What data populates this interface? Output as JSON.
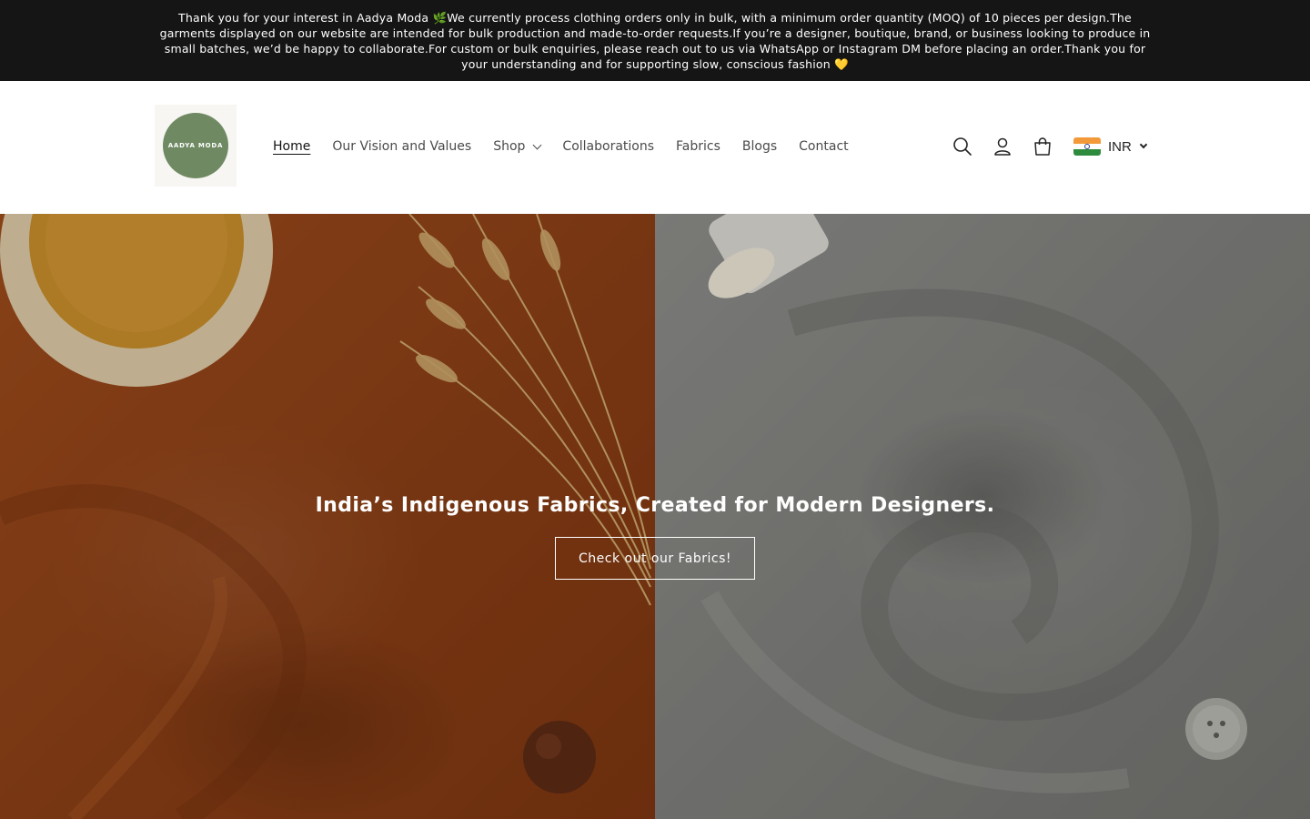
{
  "announcement": {
    "text": "Thank you for your interest in Aadya Moda 🌿We currently process clothing orders only in bulk, with a minimum order quantity (MOQ) of 10 pieces per design.The garments displayed on our website are intended for bulk production and made-to-order requests.If you’re a designer, boutique, brand, or business looking to produce in small batches, we’d be happy to collaborate.For custom or bulk enquiries, please reach out to us via WhatsApp or Instagram DM before placing an order.Thank you for your understanding and for supporting slow, conscious fashion 💛"
  },
  "header": {
    "logo_text": "AADYA MODA",
    "logo_color": "#6f8a62",
    "nav": [
      {
        "label": "Home",
        "active": true
      },
      {
        "label": "Our Vision and Values"
      },
      {
        "label": "Shop",
        "has_dropdown": true
      },
      {
        "label": "Collaborations"
      },
      {
        "label": "Fabrics"
      },
      {
        "label": "Blogs"
      },
      {
        "label": "Contact"
      }
    ],
    "icons": [
      "search-icon",
      "account-icon",
      "cart-icon"
    ],
    "currency": {
      "code": "INR",
      "flag": "india-flag-icon"
    }
  },
  "hero": {
    "heading": "India’s Indigenous Fabrics, Created for Modern Designers.",
    "button_label": "Check out our Fabrics!",
    "left_color": "#8a3f16",
    "right_color": "#7c7c79"
  }
}
